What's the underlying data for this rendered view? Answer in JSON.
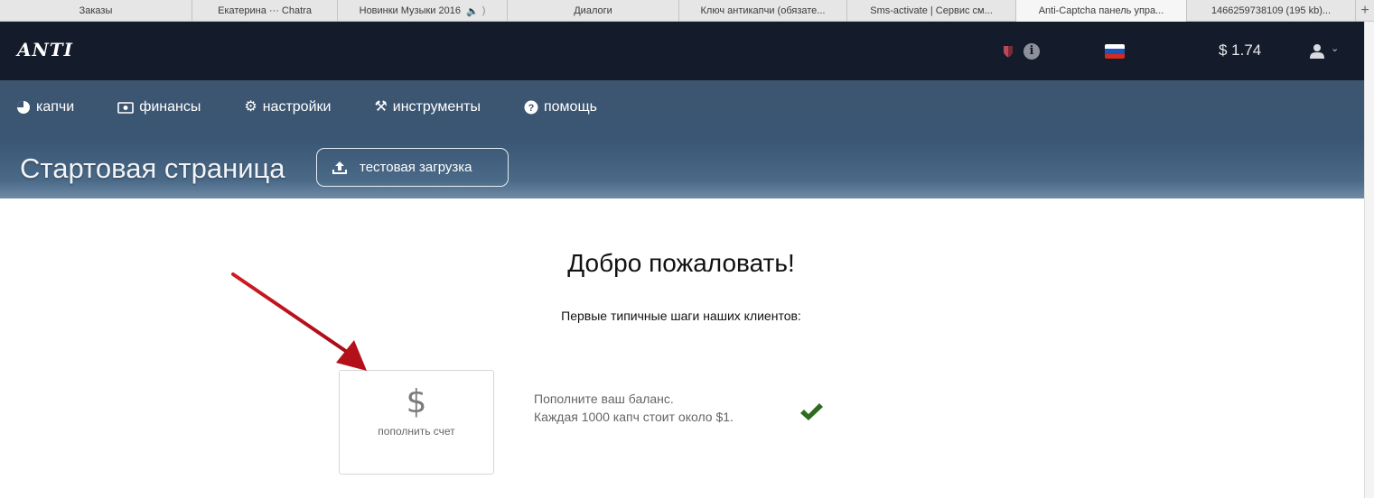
{
  "browser": {
    "tabs": [
      {
        "label": "Заказы"
      },
      {
        "label": "Екатерина ··· Chatra"
      },
      {
        "label": "Новинки Музыки 2016"
      },
      {
        "label": "Диалоги"
      },
      {
        "label": "Ключ антикапчи (обязате..."
      },
      {
        "label": "Sms-activate | Сервис см..."
      },
      {
        "label": "Anti-Captcha панель упра..."
      },
      {
        "label": "1466259738109 (195 kb)..."
      }
    ],
    "new_tab": "+"
  },
  "header": {
    "logo": "ANTI",
    "balance": "$ 1.74",
    "icons": [
      "shield-icon",
      "info-icon",
      "russia-flag-icon",
      "user-icon",
      "chevron-down-icon"
    ]
  },
  "nav": {
    "items": [
      {
        "label": "капчи",
        "icon": "pie-chart-icon"
      },
      {
        "label": "финансы",
        "icon": "money-icon"
      },
      {
        "label": "настройки",
        "icon": "gear-icon"
      },
      {
        "label": "инструменты",
        "icon": "tools-icon"
      },
      {
        "label": "помощь",
        "icon": "question-icon"
      }
    ]
  },
  "page": {
    "title": "Стартовая страница",
    "upload_button": "тестовая загрузка"
  },
  "main": {
    "welcome": "Добро пожаловать!",
    "subtitle": "Первые типичные шаги наших клиентов:",
    "step": {
      "card_symbol": "$",
      "card_label": "пополнить счет",
      "text_line1": "Пополните ваш баланс.",
      "text_line2": "Каждая 1000 капч стоит около $1."
    }
  },
  "colors": {
    "header_bg": "#141b2a",
    "nav_band": "#3d5570",
    "check": "#2f6b1e",
    "arrow": "#b3101a"
  }
}
